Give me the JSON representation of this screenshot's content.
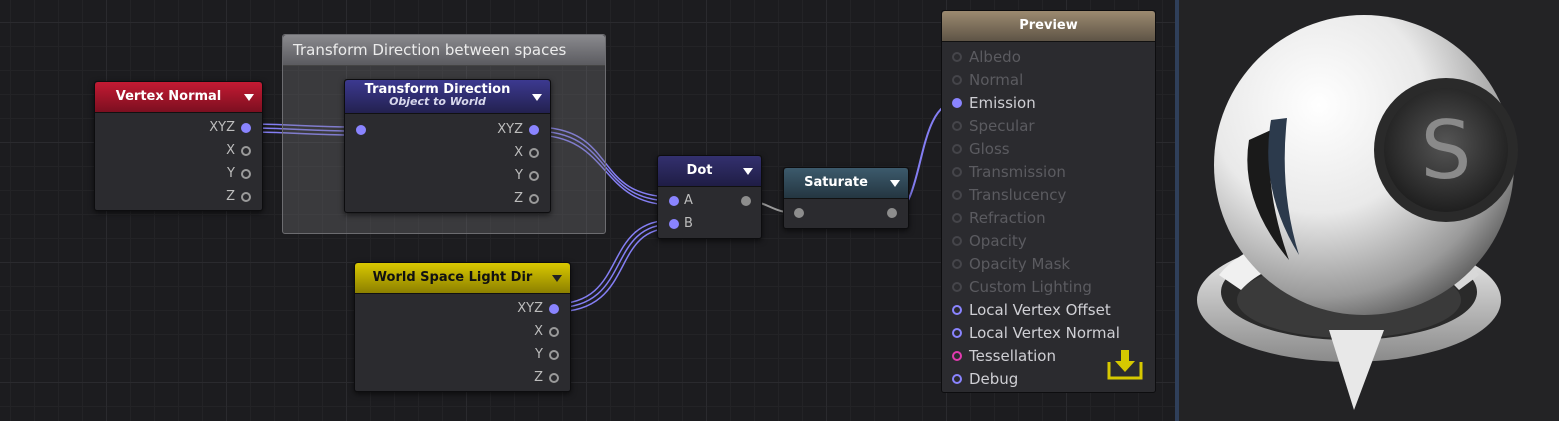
{
  "group": {
    "title": "Transform Direction between spaces"
  },
  "nodes": {
    "vertex_normal": {
      "title": "Vertex Normal",
      "color": "#a2142a",
      "outputs": [
        "XYZ",
        "X",
        "Y",
        "Z"
      ]
    },
    "transform_direction": {
      "title": "Transform Direction",
      "subtitle": "Object to World",
      "color": "#2e2c6e",
      "outputs": [
        "XYZ",
        "X",
        "Y",
        "Z"
      ]
    },
    "dot": {
      "title": "Dot",
      "color": "#2a2a5a",
      "inputs": [
        "A",
        "B"
      ]
    },
    "saturate": {
      "title": "Saturate",
      "color": "#2e4656"
    },
    "world_space_light_dir": {
      "title": "World Space Light Dir",
      "color": "#b8a800",
      "outputs": [
        "XYZ",
        "X",
        "Y",
        "Z"
      ]
    }
  },
  "preview": {
    "title": "Preview",
    "inputs": [
      {
        "label": "Albedo",
        "state": "dim"
      },
      {
        "label": "Normal",
        "state": "dim"
      },
      {
        "label": "Emission",
        "state": "on"
      },
      {
        "label": "Specular",
        "state": "dim"
      },
      {
        "label": "Gloss",
        "state": "dim"
      },
      {
        "label": "Transmission",
        "state": "dim"
      },
      {
        "label": "Translucency",
        "state": "dim"
      },
      {
        "label": "Refraction",
        "state": "dim"
      },
      {
        "label": "Opacity",
        "state": "dim"
      },
      {
        "label": "Opacity Mask",
        "state": "dim"
      },
      {
        "label": "Custom Lighting",
        "state": "dim"
      },
      {
        "label": "Local Vertex Offset",
        "state": "opt"
      },
      {
        "label": "Local Vertex Normal",
        "state": "opt"
      },
      {
        "label": "Tessellation",
        "state": "magenta"
      },
      {
        "label": "Debug",
        "state": "opt"
      }
    ]
  },
  "icons": {
    "save": "download-tray-icon",
    "logo": "shaderforge-s-logo"
  },
  "colors": {
    "connector": "#8a84ff",
    "wire": "#6b66c8",
    "tessellation": "#e23ab0",
    "save_icon": "#d6c800"
  }
}
